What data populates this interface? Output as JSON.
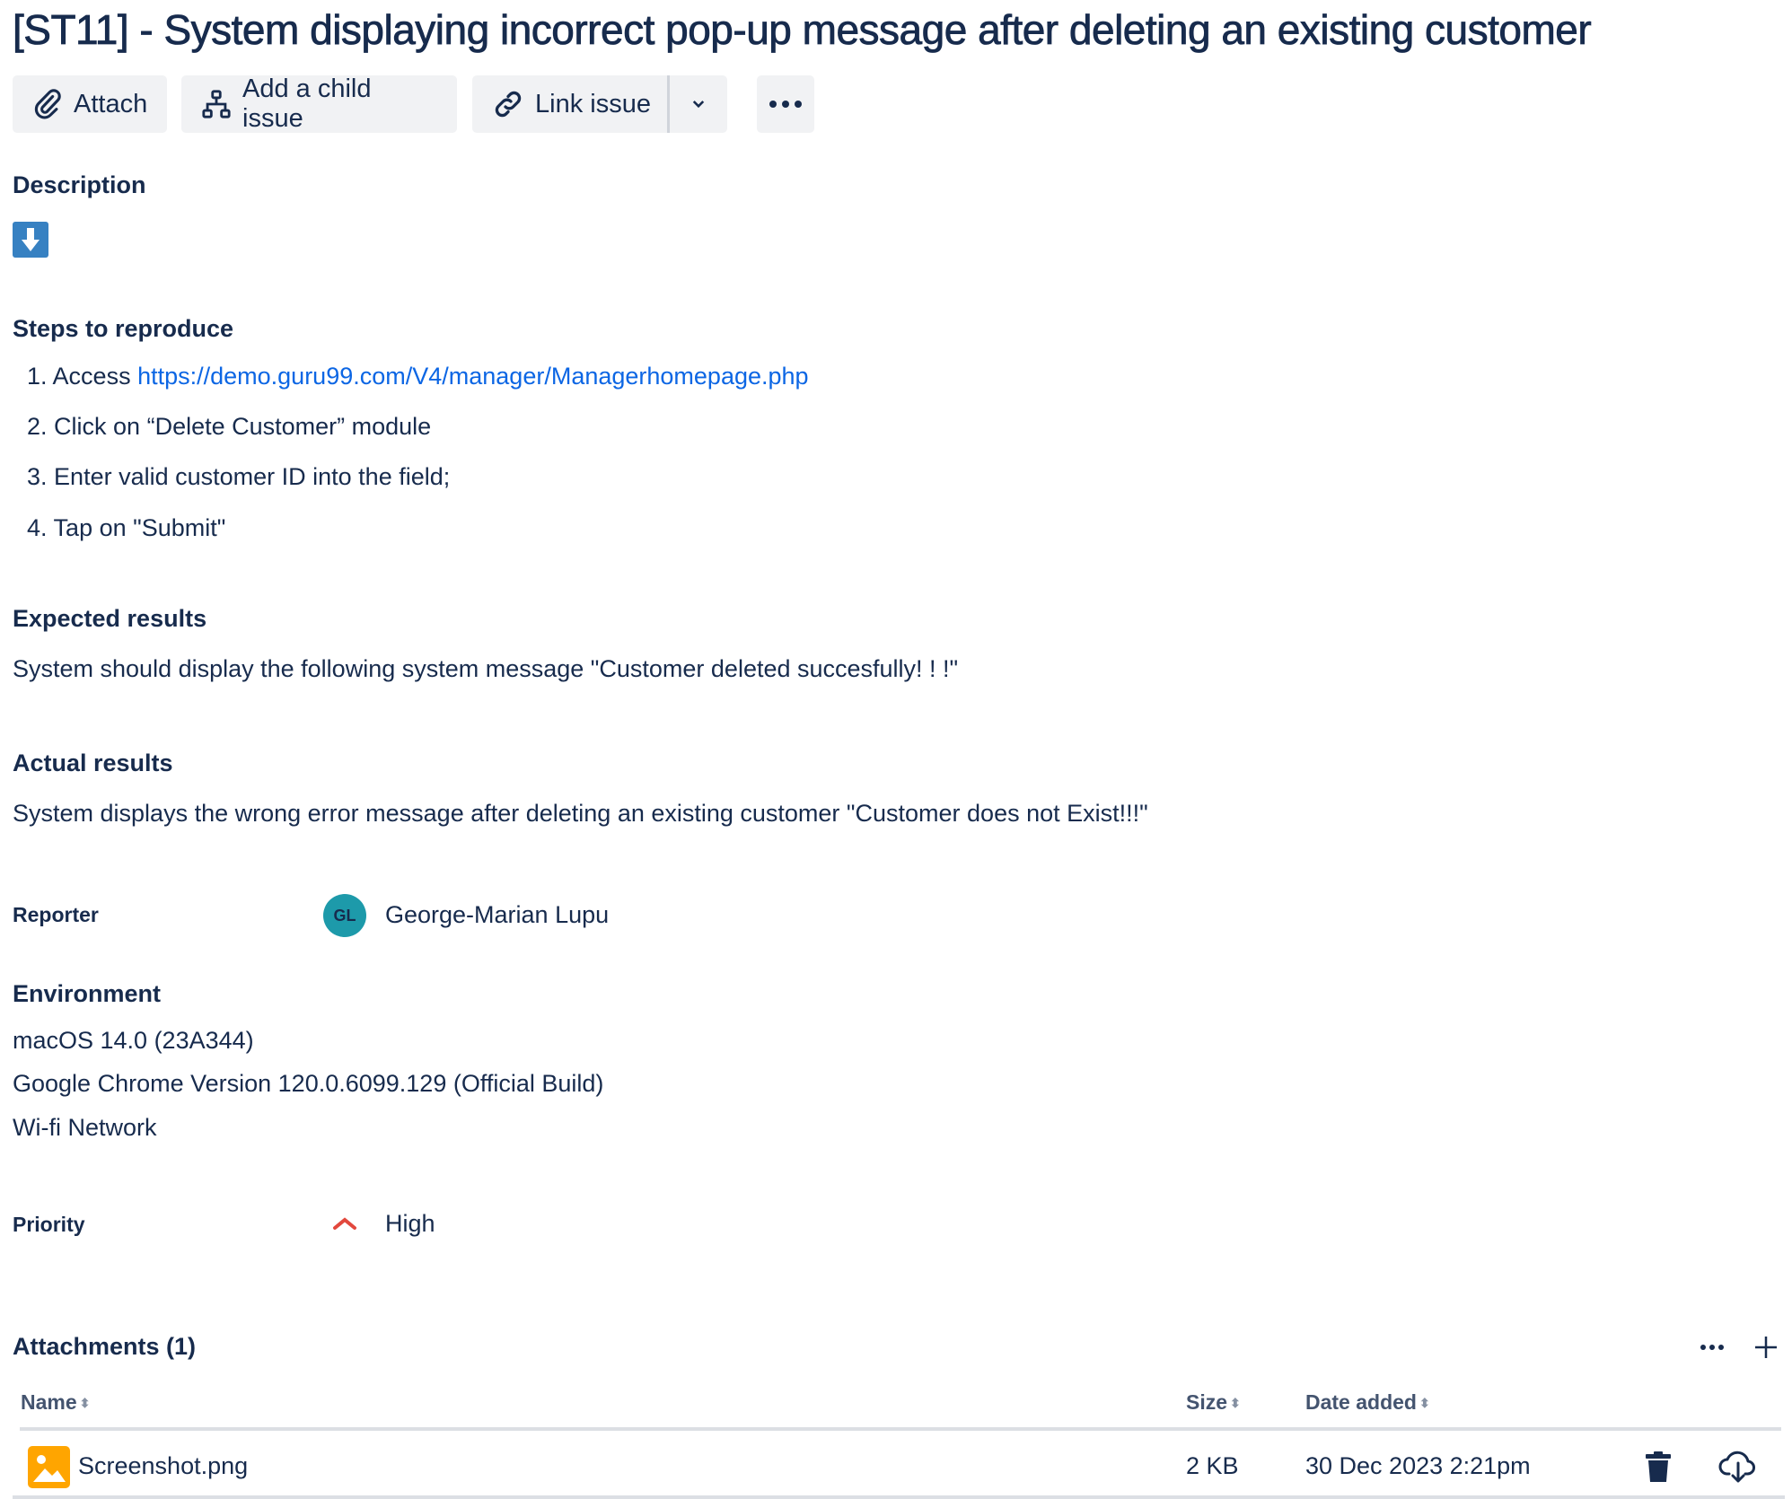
{
  "title": "[ST11] - System displaying incorrect pop-up message after deleting an existing customer",
  "toolbar": {
    "attach": "Attach",
    "add_child": "Add a child issue",
    "link_issue": "Link issue"
  },
  "description": {
    "heading": "Description",
    "steps_heading": "Steps to reproduce",
    "steps": [
      {
        "num": "1.",
        "prefix": "Access ",
        "link": "https://demo.guru99.com/V4/manager/Managerhomepage.php"
      },
      {
        "num": "2.",
        "text": "Click on “Delete Customer” module"
      },
      {
        "num": "3.",
        "text": "Enter valid customer ID into the field;"
      },
      {
        "num": "4.",
        "text": "Tap on \"Submit\""
      }
    ],
    "expected_heading": "Expected results",
    "expected": "System should display the following system message \"Customer deleted succesfully! ! !\"",
    "actual_heading": "Actual results",
    "actual": "System displays the wrong error message after deleting an existing customer \"Customer does not Exist!!!\""
  },
  "reporter": {
    "label": "Reporter",
    "initials": "GL",
    "name": "George-Marian Lupu",
    "avatar_color": "#1D9AAA"
  },
  "environment": {
    "heading": "Environment",
    "lines": [
      "macOS 14.0 (23A344)",
      "Google Chrome Version 120.0.6099.129 (Official Build)",
      "Wi-fi Network"
    ]
  },
  "priority": {
    "label": "Priority",
    "value": "High",
    "color": "#E2483D"
  },
  "attachments": {
    "heading": "Attachments (1)",
    "columns": {
      "name": "Name",
      "size": "Size",
      "date": "Date added"
    },
    "rows": [
      {
        "name": "Screenshot.png",
        "size": "2 KB",
        "date": "30 Dec 2023 2:21pm"
      }
    ]
  }
}
